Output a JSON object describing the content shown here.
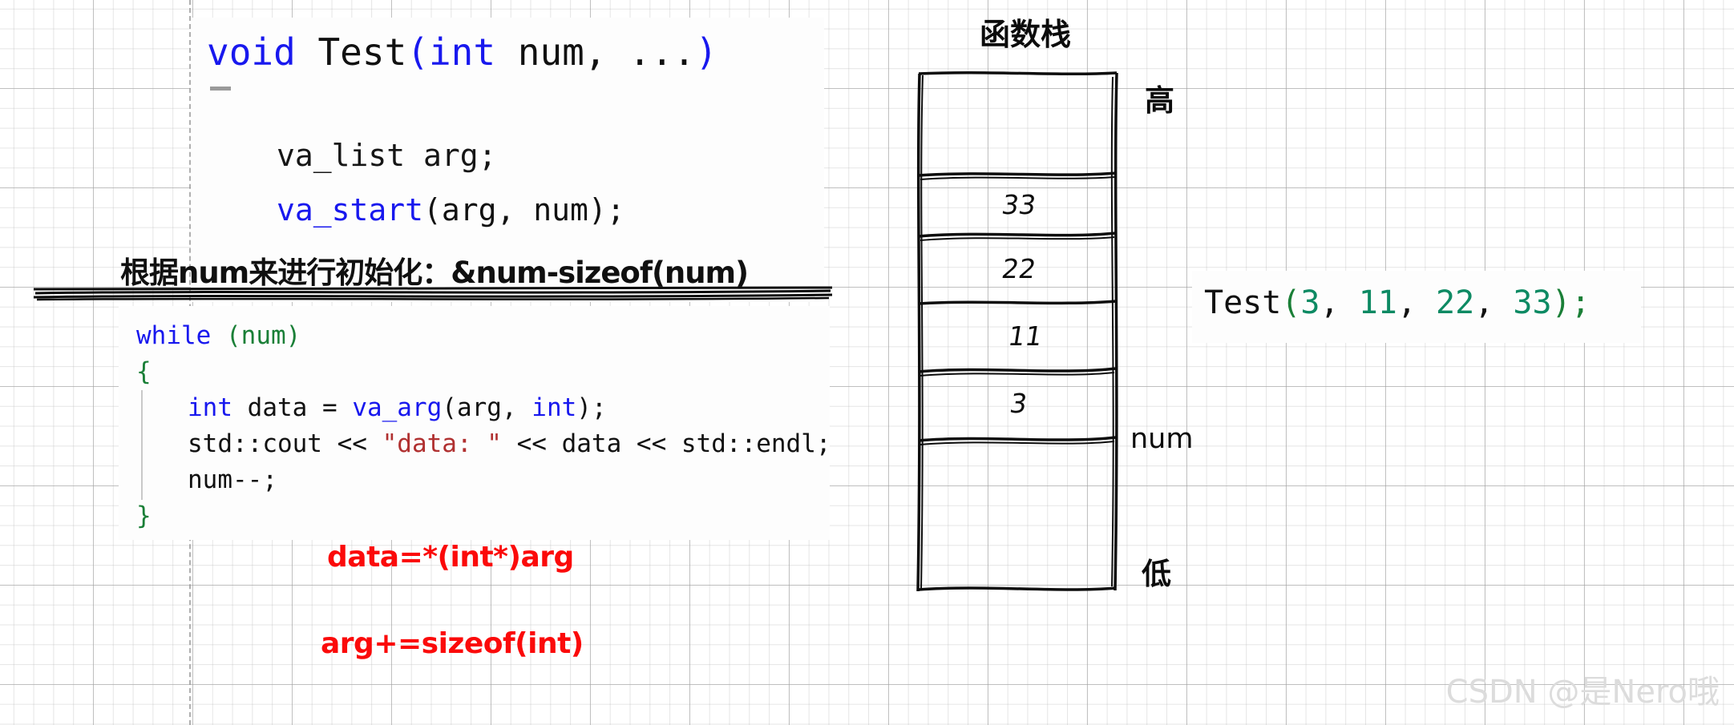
{
  "background": {
    "grid_color": "#bebebe",
    "paper_color": "#ffffff"
  },
  "colors": {
    "keyword_blue": "#1818ee",
    "paren_green": "#1a7f37",
    "number_teal": "#0d8a63",
    "string_red": "#b03030",
    "annotation_red": "#fb0a0a",
    "text_black": "#111111",
    "watermark_gray": "#dcdcdc"
  },
  "signature": {
    "void": "void",
    "space1": " ",
    "name": "Test",
    "open_paren": "(",
    "int": "int",
    "space2": " ",
    "param": "num",
    "comma": ", ",
    "ellipsis": "...",
    "close_paren": ")",
    "full_text": "void Test(int num, ...)"
  },
  "body_lines": {
    "va_list_decl": "va_list arg;",
    "va_start_name": "va_start",
    "va_start_args": "(arg, num);",
    "va_start_full": "va_start(arg, num);"
  },
  "note": {
    "text": "根据num来进行初始化：&num-sizeof(num)"
  },
  "code": {
    "line1_kw": "while",
    "line1_rest": " (num)",
    "line1_full": "while (num)",
    "line2": "{",
    "line3_kw1": "int",
    "line3_mid": " data = ",
    "line3_fn": "va_arg",
    "line3_open": "(arg, ",
    "line3_kw2": "int",
    "line3_close": ");",
    "line3_full": "int data = va_arg(arg, int);",
    "line4_pre": "std::cout << ",
    "line4_str": "\"data: \"",
    "line4_post": " << data << std::endl;",
    "line4_full": "std::cout << \"data: \" << data << std::endl;",
    "line5": "num--;",
    "line6": "}"
  },
  "annotations": {
    "red_1": "data=*(int*)arg",
    "red_2": "arg+=sizeof(int)"
  },
  "stack": {
    "title": "函数栈",
    "label_high": "高",
    "label_low": "低",
    "label_num": "num",
    "cells": [
      {
        "value": "",
        "name": "stack-cell-empty-top"
      },
      {
        "value": "33",
        "name": "stack-cell-33"
      },
      {
        "value": "22",
        "name": "stack-cell-22"
      },
      {
        "value": "11",
        "name": "stack-cell-11"
      },
      {
        "value": "3",
        "name": "stack-cell-3"
      },
      {
        "value": "",
        "name": "stack-cell-empty-bottom"
      }
    ]
  },
  "call": {
    "fn": "Test",
    "open": "(",
    "args": [
      "3",
      "11",
      "22",
      "33"
    ],
    "close": ");",
    "full_text": "Test(3, 11, 22, 33);"
  },
  "watermark": {
    "text": "CSDN @是Nero哦"
  }
}
